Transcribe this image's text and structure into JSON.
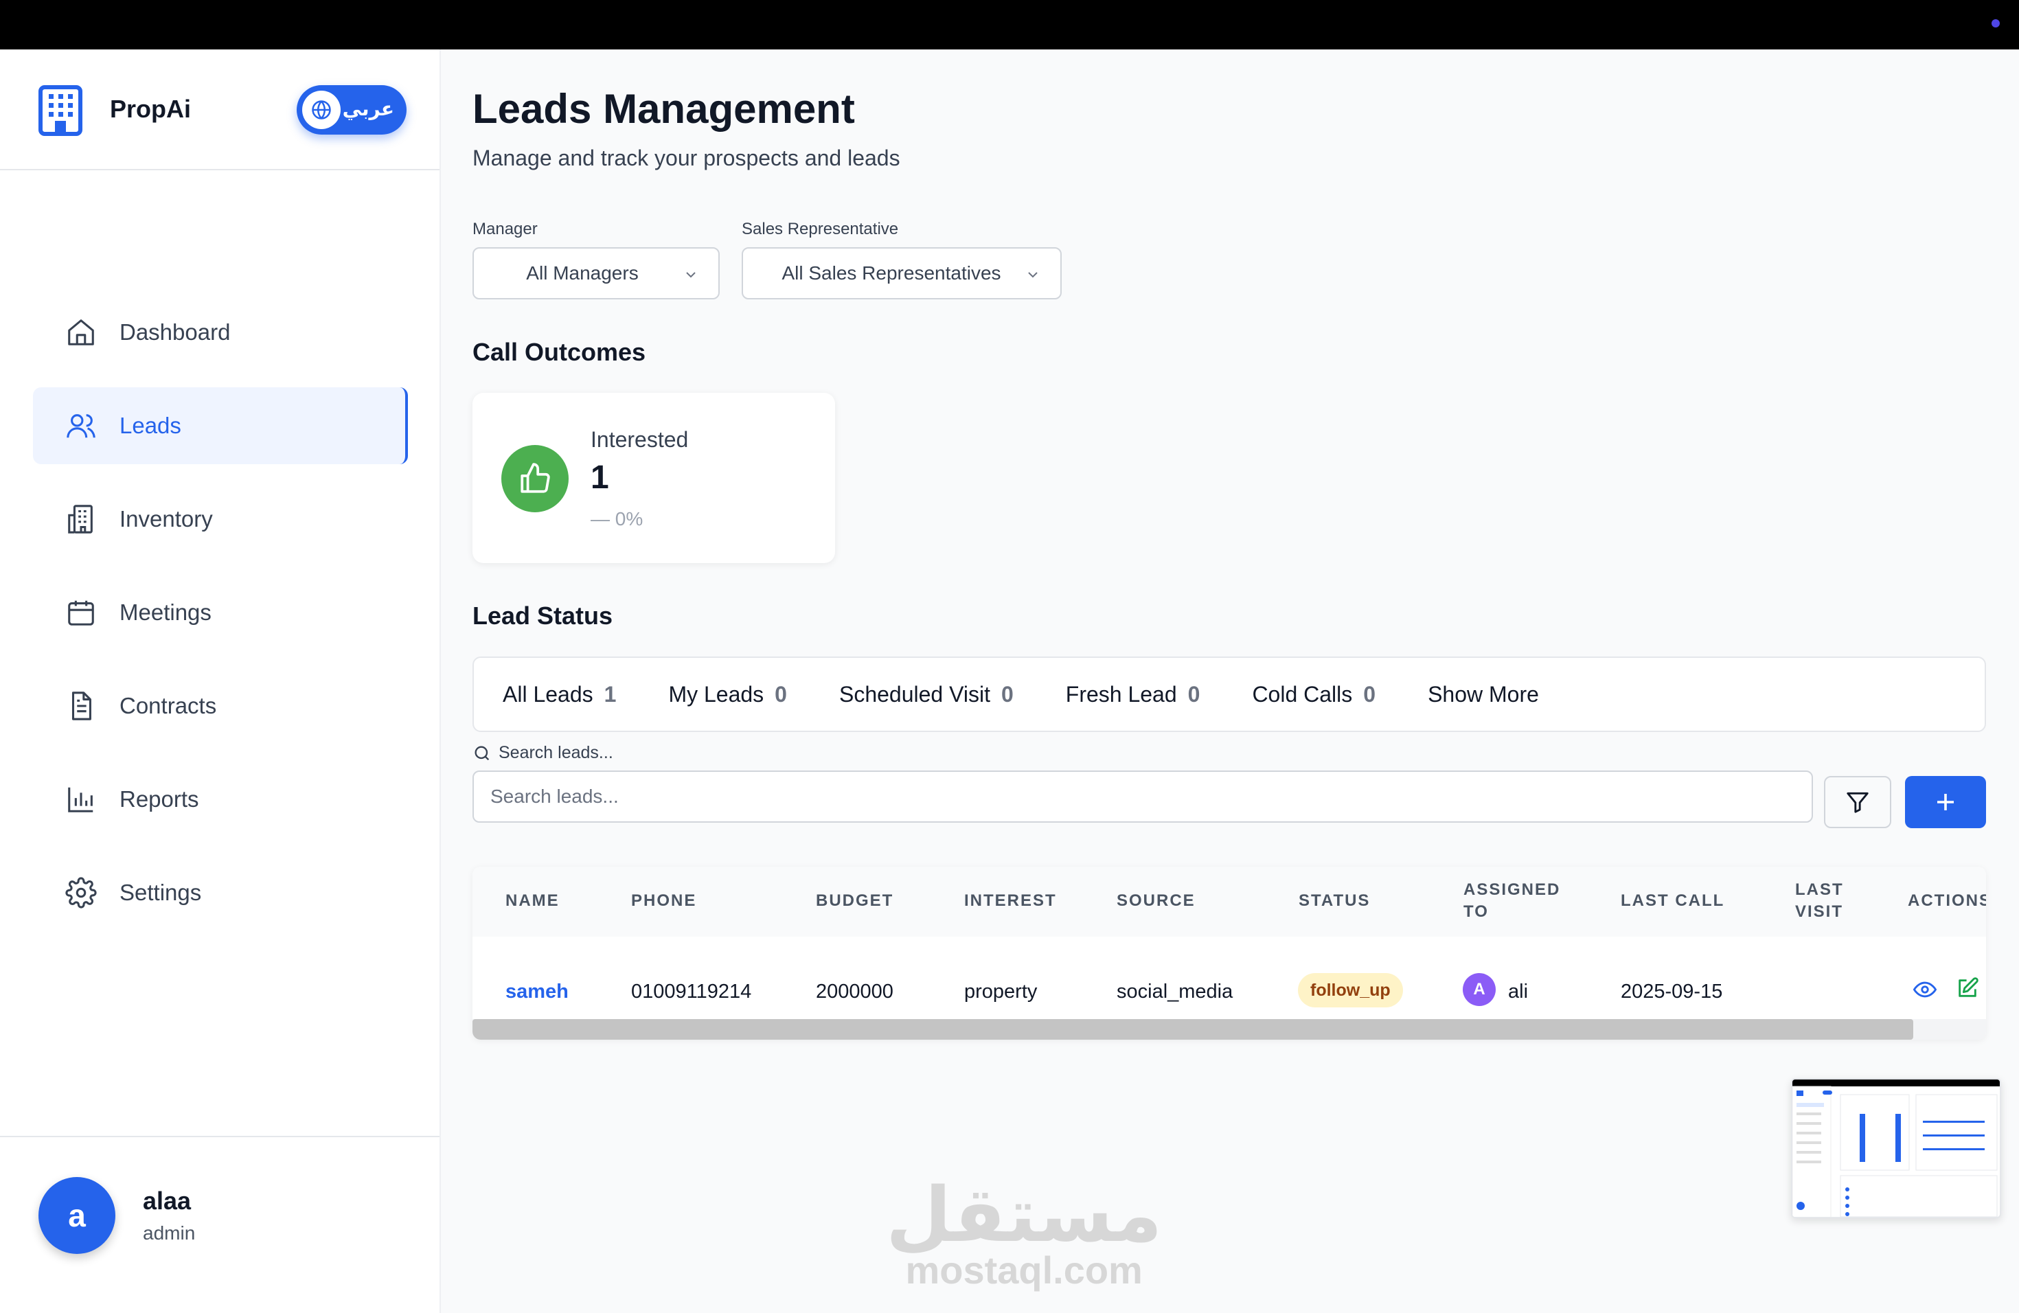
{
  "app": {
    "name": "PropAi",
    "language_toggle": "عربي"
  },
  "sidebar": {
    "items": [
      {
        "label": "Dashboard",
        "icon": "home-icon",
        "active": false
      },
      {
        "label": "Leads",
        "icon": "users-icon",
        "active": true
      },
      {
        "label": "Inventory",
        "icon": "building-icon",
        "active": false
      },
      {
        "label": "Meetings",
        "icon": "calendar-icon",
        "active": false
      },
      {
        "label": "Contracts",
        "icon": "document-icon",
        "active": false
      },
      {
        "label": "Reports",
        "icon": "bar-chart-icon",
        "active": false
      },
      {
        "label": "Settings",
        "icon": "gear-icon",
        "active": false
      }
    ]
  },
  "user": {
    "initial": "a",
    "name": "alaa",
    "role": "admin"
  },
  "page": {
    "title": "Leads Management",
    "subtitle": "Manage and track your prospects and leads"
  },
  "filters": {
    "manager": {
      "label": "Manager",
      "value": "All Managers"
    },
    "sales_rep": {
      "label": "Sales Representative",
      "value": "All Sales Representatives"
    }
  },
  "call_outcomes": {
    "title": "Call Outcomes",
    "cards": [
      {
        "label": "Interested",
        "value": "1",
        "change": "— 0%"
      }
    ]
  },
  "lead_status": {
    "title": "Lead Status",
    "tabs": [
      {
        "label": "All Leads",
        "count": "1"
      },
      {
        "label": "My Leads",
        "count": "0"
      },
      {
        "label": "Scheduled Visit",
        "count": "0"
      },
      {
        "label": "Fresh Lead",
        "count": "0"
      },
      {
        "label": "Cold Calls",
        "count": "0"
      },
      {
        "label": "Show More",
        "count": ""
      }
    ]
  },
  "search": {
    "caption": "Search leads...",
    "placeholder": "Search leads..."
  },
  "table": {
    "columns": [
      "NAME",
      "PHONE",
      "BUDGET",
      "INTEREST",
      "SOURCE",
      "STATUS",
      "ASSIGNED TO",
      "LAST CALL",
      "LAST VISIT",
      "ACTIONS"
    ],
    "rows": [
      {
        "name": "sameh",
        "phone": "01009119214",
        "budget": "2000000",
        "interest": "property",
        "source": "social_media",
        "status": "follow_up",
        "assigned_initial": "A",
        "assigned_to": "ali",
        "last_call": "2025-09-15",
        "last_visit": ""
      }
    ]
  },
  "watermark": {
    "arabic": "مستقل",
    "latin": "mostaql.com"
  },
  "colors": {
    "accent": "#2563eb",
    "success": "#4caf50",
    "badge_bg": "#fef3c7",
    "badge_text": "#92400e",
    "assignee": "#8b5cf6"
  }
}
